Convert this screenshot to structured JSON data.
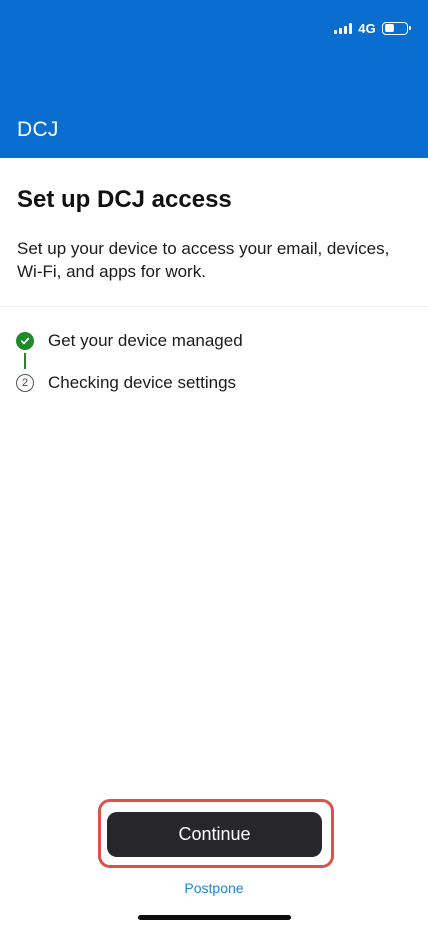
{
  "status_bar": {
    "network_label": "4G",
    "battery_level": 0.45
  },
  "header": {
    "org_name": "DCJ",
    "background_color": "#0a6ed1"
  },
  "main": {
    "title": "Set up DCJ access",
    "description": "Set up your device to access your email, devices, Wi-Fi, and apps for work."
  },
  "steps": [
    {
      "label": "Get your device managed",
      "state": "complete",
      "icon": "checkmark-icon"
    },
    {
      "label": "Checking device settings",
      "state": "pending",
      "marker": "2"
    }
  ],
  "actions": {
    "continue_label": "Continue",
    "postpone_label": "Postpone"
  },
  "colors": {
    "accent": "#0a6ed1",
    "success": "#1e8a28",
    "link": "#1a86d9",
    "primary_button": "#27262a",
    "highlight": "#d9534a"
  }
}
